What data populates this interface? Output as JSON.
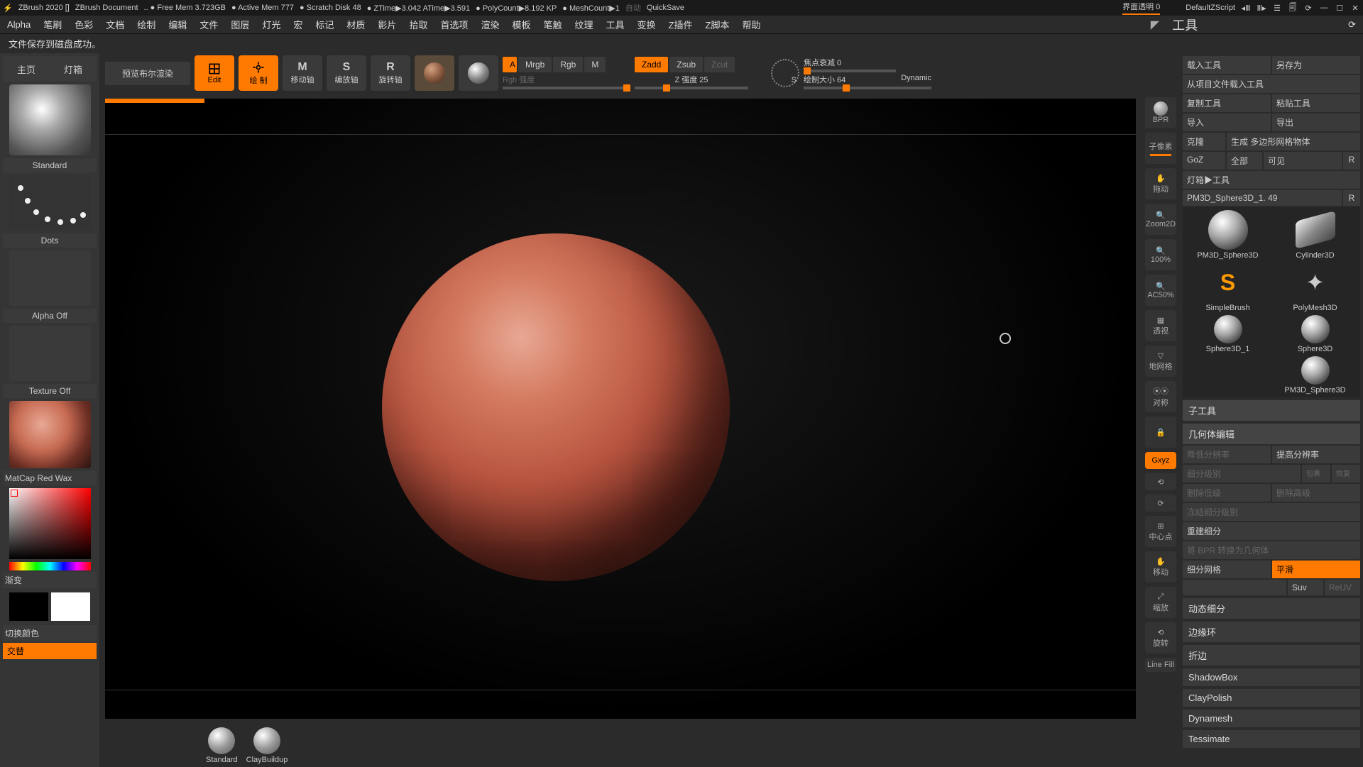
{
  "titlebar": {
    "app": "ZBrush 2020 []",
    "doc": "ZBrush Document",
    "freemem": ".. ● Free Mem 3.723GB",
    "activemem": "● Active Mem 777",
    "scratch": "● Scratch Disk 48",
    "ztime": "● ZTime▶3.042 ATime▶3.591",
    "polycount": "● PolyCount▶8.192 KP",
    "meshcount": "● MeshCount▶1",
    "auto": "自动",
    "quicksave": "QuickSave",
    "transparency": "界面透明 0",
    "zscript": "DefaultZScript"
  },
  "menu": [
    "Alpha",
    "笔刷",
    "色彩",
    "文档",
    "绘制",
    "编辑",
    "文件",
    "图层",
    "灯光",
    "宏",
    "标记",
    "材质",
    "影片",
    "拾取",
    "首选项",
    "渲染",
    "模板",
    "笔触",
    "纹理",
    "工具",
    "变换",
    "Z插件",
    "Z脚本",
    "帮助"
  ],
  "status": "文件保存到磁盘成功。",
  "left": {
    "tab1": "主页",
    "tab2": "灯箱",
    "preview_btn": "预览布尔渲染",
    "brush": "Standard",
    "stroke": "Dots",
    "alpha": "Alpha Off",
    "texture": "Texture Off",
    "material": "MatCap Red Wax",
    "gradient": "渐变",
    "switch_color": "切换颜色",
    "alternate": "交替"
  },
  "toolbar": {
    "edit": "Edit",
    "draw": "绘 制",
    "move": "移动轴",
    "scale": "编放轴",
    "rotate": "旋转轴",
    "mrgb": "Mrgb",
    "rgb": "Rgb",
    "m": "M",
    "rgb_intensity": "Rgb 强度",
    "zadd": "Zadd",
    "zsub": "Zsub",
    "zcut": "Zcut",
    "z_intensity": "Z 强度 25",
    "focal": "焦点衰减 0",
    "drawsize": "绘制大小 64",
    "dynamic": "Dynamic"
  },
  "right_icons": {
    "bpr": "BPR",
    "ziso": "子像素",
    "drag": "拖动",
    "zoom": "Zoom2D",
    "hundred": "100%",
    "half": "AC50%",
    "persp": "透视",
    "floor": "地网格",
    "sym": "对称",
    "xyz": "Gxyz",
    "frame": "中心点",
    "move": "移动",
    "scale": "缩放",
    "rotate": "旋转",
    "linefill": "Line Fill"
  },
  "panel": {
    "title": "工具",
    "load": "载入工具",
    "saveas": "另存为",
    "loadproj": "从项目文件载入工具",
    "copy": "复制工具",
    "paste": "粘贴工具",
    "import": "导入",
    "export": "导出",
    "clone": "克隆",
    "makepoly": "生成 多边形网格物体",
    "goz": "GoZ",
    "all": "全部",
    "visible": "可见",
    "r": "R",
    "lightbox": "灯箱▶工具",
    "current": "PM3D_Sphere3D_1. 49",
    "tools": [
      "PM3D_Sphere3D",
      "Cylinder3D",
      "SimpleBrush",
      "PolyMesh3D",
      "Sphere3D_1",
      "Sphere3D",
      "PM3D_Sphere3D"
    ],
    "subtool": "子工具",
    "geometry": "几何体编辑",
    "geo": {
      "lower": "降低分辨率",
      "higher": "提高分辨率",
      "sdiv": "细分级别",
      "cage": "包裹",
      "restore": "恢复",
      "dellow": "删除低级",
      "delhigh": "删除高级",
      "freeze": "冻结细分级别",
      "reconstruct": "重建细分",
      "bpr2geo": "将 BPR 转换为几何体",
      "divide": "细分网格",
      "smt": "平滑",
      "suv": "Suv",
      "reuv": "ReUV",
      "dynamic_sub": "动态细分",
      "edgeloop": "边缘环",
      "crease": "折边",
      "shadowbox": "ShadowBox",
      "claypolish": "ClayPolish",
      "dynamesh": "Dynamesh",
      "tessimate": "Tessimate"
    }
  },
  "bottom": {
    "brush1": "Standard",
    "brush2": "ClayBuildup"
  }
}
